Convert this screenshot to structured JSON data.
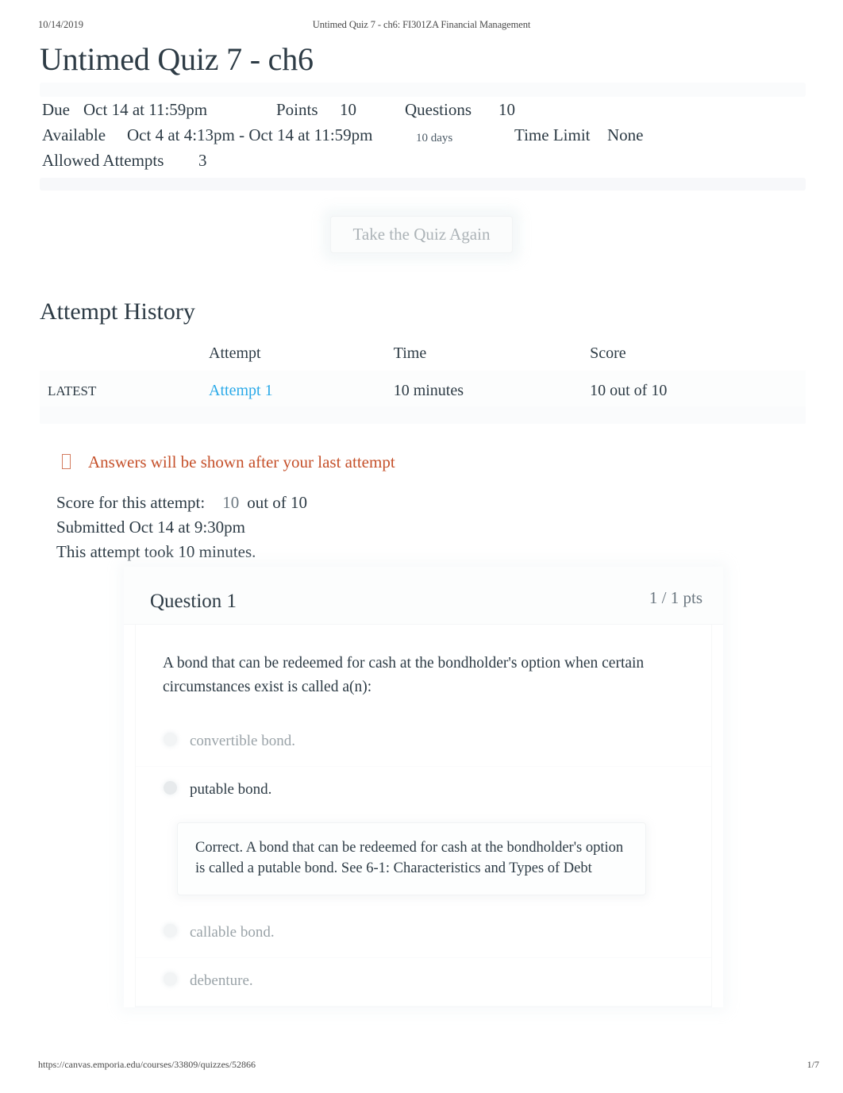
{
  "print": {
    "date": "10/14/2019",
    "doc_title": "Untimed Quiz 7 - ch6: FI301ZA Financial Management",
    "url": "https://canvas.emporia.edu/courses/33809/quizzes/52866",
    "page_number": "1/7"
  },
  "quiz": {
    "title": "Untimed Quiz 7 - ch6",
    "meta": {
      "due_label": "Due",
      "due_value": "Oct 14 at 11:59pm",
      "points_label": "Points",
      "points_value": "10",
      "questions_label": "Questions",
      "questions_value": "10",
      "available_label": "Available",
      "available_value": "Oct 4 at 4:13pm - Oct 14 at 11:59pm",
      "available_duration": "10 days",
      "time_limit_label": "Time Limit",
      "time_limit_value": "None",
      "allowed_attempts_label": "Allowed Attempts",
      "allowed_attempts_value": "3"
    },
    "retake_button": "Take the Quiz Again"
  },
  "attempt_history": {
    "heading": "Attempt History",
    "columns": [
      "",
      "Attempt",
      "Time",
      "Score"
    ],
    "rows": [
      {
        "flag": "LATEST",
        "attempt": "Attempt 1",
        "time": "10 minutes",
        "score": "10 out of 10"
      }
    ]
  },
  "notice": {
    "text": "Answers will be shown after your last attempt",
    "color": "#c5502a"
  },
  "attempt_summary": {
    "score_label": "Score for this attempt:",
    "score_value": "10",
    "score_suffix": "out of 10",
    "submitted": "Submitted Oct 14 at 9:30pm",
    "duration": "This attempt took 10 minutes."
  },
  "question": {
    "label": "Question 1",
    "points": "1 / 1 pts",
    "text": "A bond that can be redeemed for cash at the bondholder's option when certain circumstances exist is called a(n):",
    "answers": [
      {
        "label": "convertible bond.",
        "selected": false
      },
      {
        "label": "putable bond.",
        "selected": true
      },
      {
        "label": "callable bond.",
        "selected": false
      },
      {
        "label": "debenture.",
        "selected": false
      }
    ],
    "feedback": "Correct. A bond that can be redeemed for cash at the bondholder's option is called a putable bond. See 6-1: Characteristics and Types of Debt"
  },
  "colors": {
    "link": "#29a9e8",
    "notice": "#c5502a",
    "text": "#2d3b45",
    "muted": "#9aa3a8"
  }
}
